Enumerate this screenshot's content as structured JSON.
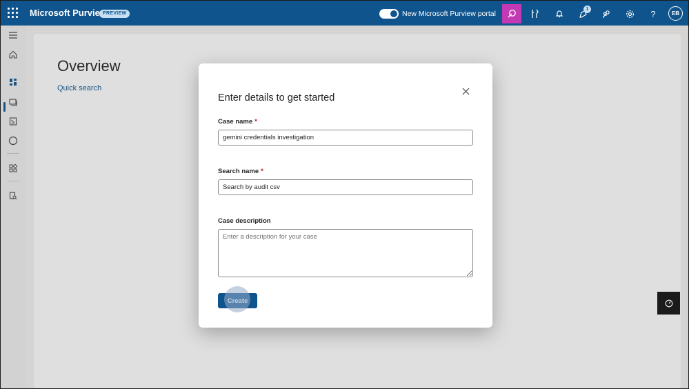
{
  "topbar": {
    "brand": "Microsoft Purview",
    "badge": "PREVIEW",
    "portal_toggle_label": "New Microsoft Purview portal",
    "notification_count": "1",
    "avatar_initials": "EB",
    "icons": [
      "waffle-icon",
      "copilot-icon",
      "tools-icon",
      "bell-icon",
      "notification-icon",
      "people-icon",
      "gear-icon",
      "help-icon"
    ]
  },
  "rail": {
    "icons": [
      "hamburger-icon",
      "home-icon",
      "overview-icon",
      "cases-icon",
      "document-icon",
      "circle-icon",
      "apps-icon",
      "search-icon"
    ]
  },
  "main": {
    "title": "Overview",
    "quick_search": "Quick search"
  },
  "dialog": {
    "title": "Enter details to get started",
    "case_name_label": "Case name",
    "case_name_value": "gemini credentials investigation",
    "search_name_label": "Search name",
    "search_name_value": "Search by audit csv",
    "description_label": "Case description",
    "description_placeholder": "Enter a description for your case",
    "required_marker": "*",
    "create_label": "Create"
  },
  "colors": {
    "topbar": "#0f548c",
    "accent": "#0f548c",
    "copilot_active": "#c239b3",
    "required": "#c50f1f"
  }
}
